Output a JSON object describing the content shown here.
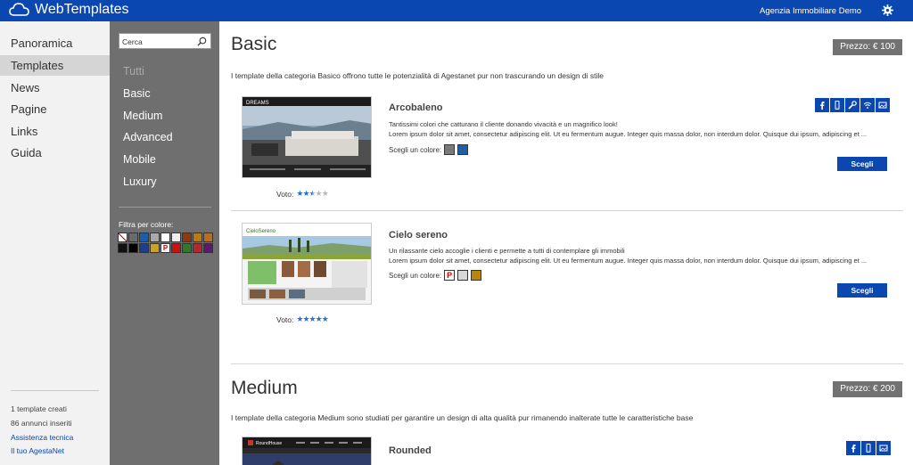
{
  "app": {
    "brand": "WebTemplates",
    "agency": "Agenzia Immobiliare Demo"
  },
  "nav": {
    "items": [
      "Panoramica",
      "Templates",
      "News",
      "Pagine",
      "Links",
      "Guida"
    ],
    "active": "Templates"
  },
  "footer": {
    "templates_created": "1 template creati",
    "ads_inserted": "86 annunci inseriti",
    "support": "Assistenza tecnica",
    "your_account": "Il tuo AgestaNet"
  },
  "categories": {
    "search_placeholder": "Cerca",
    "items": [
      "Tutti",
      "Basic",
      "Medium",
      "Advanced",
      "Mobile",
      "Luxury"
    ],
    "filter_label": "Filtra per colore:",
    "swatch_rows": [
      [
        "none",
        "#6b6b6b",
        "#1a5fae",
        "#a9a9a9",
        "#ffffff",
        "#eeeeee",
        "#8a3b12",
        "#b87a14",
        "#b86e20"
      ],
      [
        "#111111",
        "#000000",
        "#1a3f8f",
        "#c9a227",
        "P",
        "#cc1111",
        "#2f7a2a",
        "#b22a2a",
        "#5a1a6e"
      ]
    ]
  },
  "sections": [
    {
      "title": "Basic",
      "price": "Prezzo: € 100",
      "description": "I template della categoria Basico offrono tutte le potenzialità di Agestanet pur non trascurando un design di stile",
      "templates": [
        {
          "name": "Arcobaleno",
          "line1": "Tantissimi colori che catturano il cliente donando vivacità e un magnifico look!",
          "line2": "Lorem ipsum dolor sit amet, consectetur adipiscing elit. Ut eu fermentum augue. Integer quis massa dolor, non interdum dolor. Quisque dui ipsum, adipiscing et ...",
          "choose_color": "Scegli un colore:",
          "colors": [
            "#7a7a7a",
            "#1d5fa8"
          ],
          "button": "Scegli",
          "vote_label": "Voto:",
          "rating": 2.5,
          "features": [
            "facebook-icon",
            "mobile-icon",
            "wrench-icon",
            "wifi-icon",
            "image-icon"
          ]
        },
        {
          "name": "Cielo sereno",
          "line1": "Un rilassante cielo accoglie i clienti e permette a tutti di contemplare gli immobili",
          "line2": "Lorem ipsum dolor sit amet, consectetur adipiscing elit. Ut eu fermentum augue. Integer quis massa dolor, non interdum dolor. Quisque dui ipsum, adipiscing et ...",
          "choose_color": "Scegli un colore:",
          "colors": [
            "P",
            "#d8d8d8",
            "#b8860b"
          ],
          "button": "Scegli",
          "vote_label": "Voto:",
          "rating": 5
        }
      ]
    },
    {
      "title": "Medium",
      "price": "Prezzo: € 200",
      "description": "I template della categoria Medium sono studiati per garantire un design di alta qualità pur rimanendo inalterate tutte le caratteristiche base",
      "templates": [
        {
          "name": "Rounded",
          "features": [
            "facebook-icon",
            "mobile-icon",
            "image-icon"
          ]
        }
      ]
    }
  ],
  "thumbs": {
    "arcobaleno": {
      "logo": "DREAMS"
    },
    "cielo": {
      "logo": "CieloSereno"
    },
    "rounded": {
      "logo": "RoundHouse"
    }
  }
}
